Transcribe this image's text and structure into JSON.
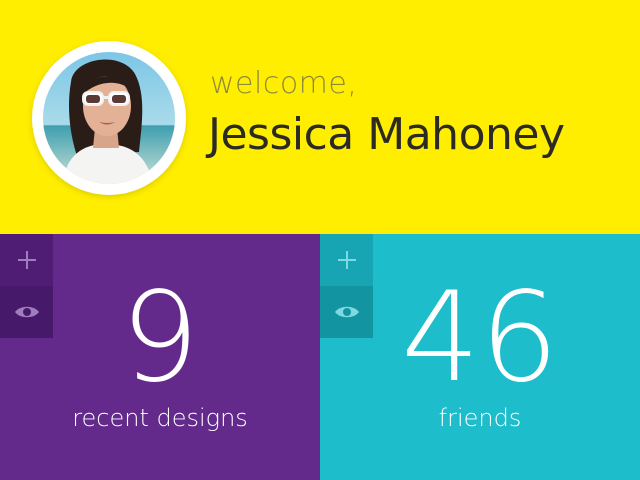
{
  "colors": {
    "header_bg": "#FFEE00",
    "welcome_text": "#8F8A3A",
    "name_text": "#2B2A23",
    "designs_bg": "#632A8C",
    "designs_action_add_bg": "#4F1E74",
    "designs_action_view_bg": "#46196A",
    "designs_icon": "#9F7DBF",
    "friends_bg": "#1DBDCC",
    "friends_action_add_bg": "#17A5B3",
    "friends_action_view_bg": "#1294A1",
    "friends_icon": "#7FD9E2"
  },
  "header": {
    "welcome": "welcome,",
    "name": "Jessica Mahoney",
    "avatar_icon": "user-photo"
  },
  "tiles": [
    {
      "id": "designs",
      "value": "9",
      "label": "recent designs",
      "add_icon": "plus-icon",
      "view_icon": "eye-icon"
    },
    {
      "id": "friends",
      "value": "46",
      "label": "friends",
      "add_icon": "plus-icon",
      "view_icon": "eye-icon"
    }
  ]
}
